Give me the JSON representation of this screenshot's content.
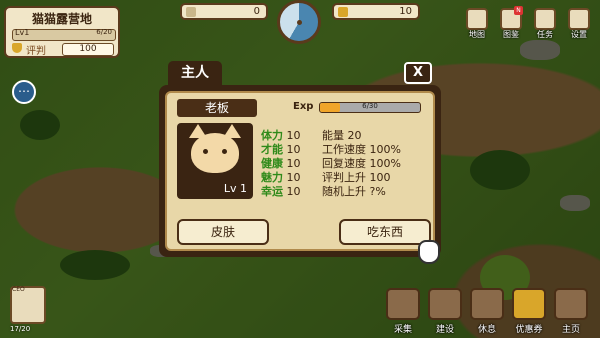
{
  "camp": {
    "name": "猫猫露营地",
    "level": "Lv1",
    "level_progress": "6/20",
    "reputation_label": "评判",
    "reputation_value": "100"
  },
  "resources": {
    "left_value": "0",
    "right_value": "10"
  },
  "top_menu": [
    {
      "label": "地图",
      "icon": "map-icon"
    },
    {
      "label": "图鉴",
      "icon": "encyclopedia-icon",
      "badge": "N"
    },
    {
      "label": "任务",
      "icon": "quest-icon"
    },
    {
      "label": "设置",
      "icon": "gear-icon"
    }
  ],
  "dialog": {
    "title": "主人",
    "close_label": "X",
    "name": "老板",
    "exp_label": "Exp",
    "exp_text": "6/30",
    "exp_fraction": 0.2,
    "portrait_level": "Lv 1",
    "stats_left": [
      {
        "label": "体力",
        "value": "10"
      },
      {
        "label": "才能",
        "value": "10"
      },
      {
        "label": "健康",
        "value": "10"
      },
      {
        "label": "魅力",
        "value": "10"
      },
      {
        "label": "幸运",
        "value": "10"
      }
    ],
    "stats_right": [
      {
        "label": "能量",
        "value": "20"
      },
      {
        "label": "工作速度",
        "value": "100%"
      },
      {
        "label": "回复速度",
        "value": "100%"
      },
      {
        "label": "评判上升",
        "value": "100"
      },
      {
        "label": "随机上升",
        "value": "?%"
      }
    ],
    "skin_button": "皮肤",
    "eat_button": "吃东西"
  },
  "ceo": {
    "tag": "CEO",
    "count": "17/20"
  },
  "bottom_menu": [
    {
      "label": "采集",
      "icon": "gather-icon"
    },
    {
      "label": "建设",
      "icon": "build-icon"
    },
    {
      "label": "休息",
      "icon": "rest-icon"
    },
    {
      "label": "优惠券",
      "icon": "coupon-icon"
    },
    {
      "label": "主页",
      "icon": "home-icon"
    }
  ],
  "colors": {
    "accent": "#3a2412",
    "panel": "#e8d7a8",
    "stat_label": "#2f8a1a",
    "exp_fill": "#f0a52a"
  }
}
